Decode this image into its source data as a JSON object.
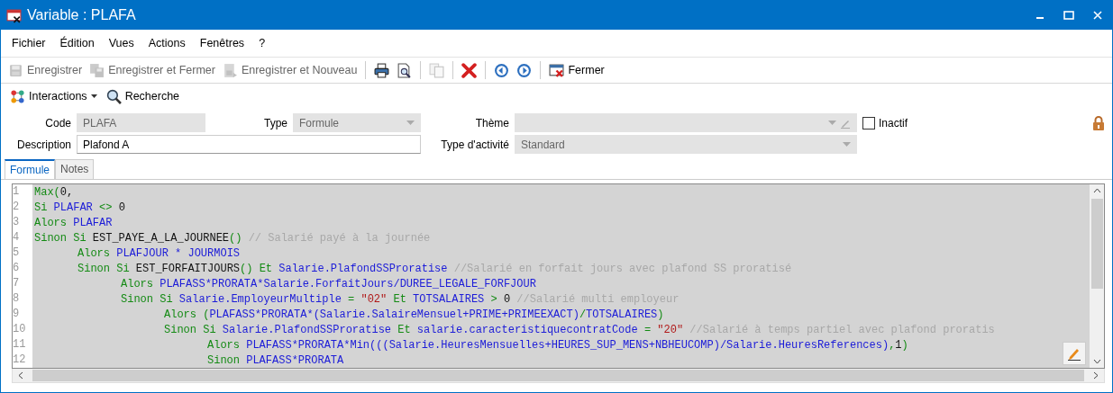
{
  "window": {
    "title": "Variable : PLAFA"
  },
  "menu": [
    "Fichier",
    "Édition",
    "Vues",
    "Actions",
    "Fenêtres",
    "?"
  ],
  "toolbar": [
    {
      "kind": "labeled",
      "label": "Enregistrer",
      "disabled": true
    },
    {
      "kind": "labeled",
      "label": "Enregistrer et Fermer",
      "disabled": true
    },
    {
      "kind": "labeled",
      "label": "Enregistrer et Nouveau",
      "disabled": true
    },
    {
      "kind": "separator"
    },
    {
      "kind": "icon",
      "disabled": false
    },
    {
      "kind": "icon",
      "disabled": false
    },
    {
      "kind": "separator"
    },
    {
      "kind": "icon",
      "disabled": true
    },
    {
      "kind": "separator"
    },
    {
      "kind": "icon",
      "disabled": false
    },
    {
      "kind": "separator"
    },
    {
      "kind": "icon",
      "disabled": false
    },
    {
      "kind": "icon",
      "disabled": false
    },
    {
      "kind": "separator"
    },
    {
      "kind": "labeled",
      "label": "Fermer",
      "disabled": false
    }
  ],
  "secondary_toolbar": [
    {
      "kind": "menu",
      "label": "Interactions"
    },
    {
      "kind": "button",
      "label": "Recherche"
    }
  ],
  "form": {
    "code": {
      "label": "Code",
      "value": "PLAFA",
      "disabled": true
    },
    "type": {
      "label": "Type",
      "value": "Formule",
      "disabled": true
    },
    "theme": {
      "label": "Thème",
      "disabled": true
    },
    "inactive": {
      "label": "Inactif",
      "checked": false
    },
    "description": {
      "label": "Description",
      "value": "Plafond A",
      "disabled": false
    },
    "activity_type": {
      "label": "Type d'activité",
      "value": "Standard",
      "disabled": true
    }
  },
  "tabs": [
    {
      "label": "Formule",
      "selected": true
    },
    {
      "label": "Notes",
      "selected": false
    }
  ],
  "editor": {
    "lines": [
      {
        "number": "1",
        "tokens": [
          {
            "kind": "kw",
            "text": "Max("
          },
          {
            "kind": "plain",
            "text": "0,"
          }
        ]
      },
      {
        "number": "2",
        "tokens": [
          {
            "kind": "kw",
            "text": "Si "
          },
          {
            "kind": "id",
            "text": "PLAFAR "
          },
          {
            "kind": "kw",
            "text": "<> "
          },
          {
            "kind": "plain",
            "text": "0"
          }
        ]
      },
      {
        "number": "3",
        "tokens": [
          {
            "kind": "kw",
            "text": "Alors "
          },
          {
            "kind": "id",
            "text": "PLAFAR"
          }
        ]
      },
      {
        "number": "4",
        "tokens": [
          {
            "kind": "kw",
            "text": "Sinon Si "
          },
          {
            "kind": "plain",
            "text": "EST_PAYE_A_LA_JOURNEE"
          },
          {
            "kind": "kw",
            "text": "() "
          },
          {
            "kind": "comment",
            "text": "// Salarié payé à la journée"
          }
        ],
        "children": [
          {
            "number": "5",
            "tokens": [
              {
                "kind": "kw",
                "text": "Alors "
              },
              {
                "kind": "id",
                "text": "PLAFJOUR * JOURMOIS"
              }
            ]
          },
          {
            "number": "6",
            "tokens": [
              {
                "kind": "kw",
                "text": "Sinon Si "
              },
              {
                "kind": "plain",
                "text": "EST_FORFAITJOURS"
              },
              {
                "kind": "kw",
                "text": "() Et "
              },
              {
                "kind": "id",
                "text": "Salarie.PlafondSSProratise "
              },
              {
                "kind": "comment",
                "text": "//Salarié en forfait jours avec plafond SS proratisé"
              }
            ],
            "children": [
              {
                "number": "7",
                "tokens": [
                  {
                    "kind": "kw",
                    "text": "Alors "
                  },
                  {
                    "kind": "id",
                    "text": "PLAFASS*PRORATA*Salarie.ForfaitJours/DUREE_LEGALE_FORFJOUR"
                  }
                ]
              },
              {
                "number": "8",
                "tokens": [
                  {
                    "kind": "kw",
                    "text": "Sinon Si "
                  },
                  {
                    "kind": "id",
                    "text": "Salarie.EmployeurMultiple "
                  },
                  {
                    "kind": "kw",
                    "text": "= "
                  },
                  {
                    "kind": "string",
                    "text": "\"02\""
                  },
                  {
                    "kind": "kw",
                    "text": " Et "
                  },
                  {
                    "kind": "id",
                    "text": "TOTSALAIRES "
                  },
                  {
                    "kind": "kw",
                    "text": "> "
                  },
                  {
                    "kind": "plain",
                    "text": "0 "
                  },
                  {
                    "kind": "comment",
                    "text": "//Salarié multi employeur"
                  }
                ],
                "children": [
                  {
                    "number": "9",
                    "tokens": [
                      {
                        "kind": "kw",
                        "text": "Alors ("
                      },
                      {
                        "kind": "id",
                        "text": "PLAFASS*PRORATA*(Salarie.SalaireMensuel+PRIME+PRIMEEXACT)"
                      },
                      {
                        "kind": "kw",
                        "text": "/"
                      },
                      {
                        "kind": "id",
                        "text": "TOTSALAIRES"
                      },
                      {
                        "kind": "kw",
                        "text": ")"
                      }
                    ]
                  },
                  {
                    "number": "10",
                    "tokens": [
                      {
                        "kind": "kw",
                        "text": "Sinon Si "
                      },
                      {
                        "kind": "id",
                        "text": "Salarie.PlafondSSProratise "
                      },
                      {
                        "kind": "kw",
                        "text": "Et "
                      },
                      {
                        "kind": "id",
                        "text": "salarie.caracteristiquecontratCode "
                      },
                      {
                        "kind": "kw",
                        "text": "= "
                      },
                      {
                        "kind": "string",
                        "text": "\"20\" "
                      },
                      {
                        "kind": "comment",
                        "text": "//Salarié à temps partiel avec plafond proratis"
                      }
                    ],
                    "children": [
                      {
                        "number": "11",
                        "tokens": [
                          {
                            "kind": "kw",
                            "text": "Alors "
                          },
                          {
                            "kind": "id",
                            "text": "PLAFASS*PRORATA*Min(((Salarie.HeuresMensuelles+HEURES_SUP_MENS+NBHEUCOMP)/Salarie.HeuresReferences)"
                          },
                          {
                            "kind": "kw",
                            "text": ","
                          },
                          {
                            "kind": "plain",
                            "text": "1"
                          },
                          {
                            "kind": "kw",
                            "text": ")"
                          }
                        ]
                      },
                      {
                        "number": "12",
                        "tokens": [
                          {
                            "kind": "kw",
                            "text": "Sinon "
                          },
                          {
                            "kind": "id",
                            "text": "PLAFASS*PRORATA"
                          }
                        ]
                      }
                    ]
                  }
                ]
              }
            ]
          }
        ]
      }
    ]
  }
}
